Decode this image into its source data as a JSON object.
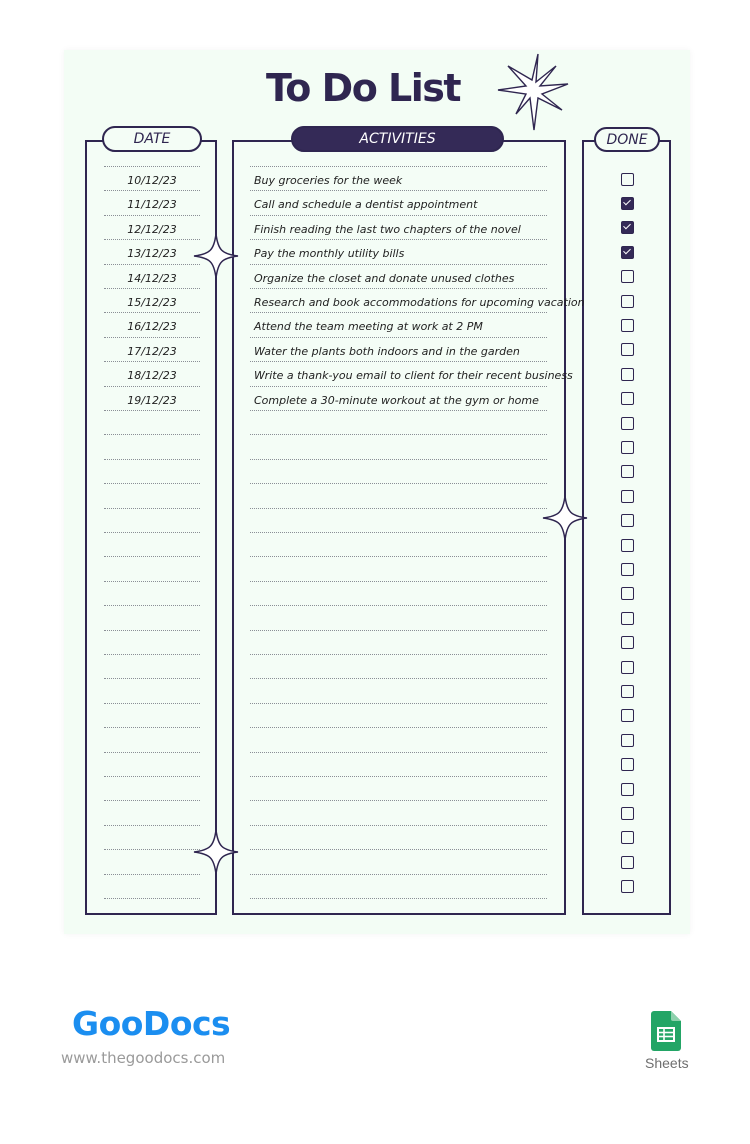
{
  "title": "To Do List",
  "columns": {
    "date": "DATE",
    "activities": "ACTIVITIES",
    "done": "DONE"
  },
  "rows": [
    {
      "date": "10/12/23",
      "activity": "Buy groceries for the week",
      "done": false
    },
    {
      "date": "11/12/23",
      "activity": "Call and schedule a dentist appointment",
      "done": true
    },
    {
      "date": "12/12/23",
      "activity": "Finish reading the last two chapters of the novel",
      "done": true
    },
    {
      "date": "13/12/23",
      "activity": "Pay the monthly utility bills",
      "done": true
    },
    {
      "date": "14/12/23",
      "activity": "Organize the closet and donate unused clothes",
      "done": false
    },
    {
      "date": "15/12/23",
      "activity": "Research and book accommodations for upcoming vacation",
      "done": false
    },
    {
      "date": "16/12/23",
      "activity": "Attend the team meeting at work at 2 PM",
      "done": false
    },
    {
      "date": "17/12/23",
      "activity": "Water the plants both indoors and in the garden",
      "done": false
    },
    {
      "date": "18/12/23",
      "activity": "Write a thank-you email to client for their recent business",
      "done": false
    },
    {
      "date": "19/12/23",
      "activity": "Complete a 30-minute workout at the gym or home",
      "done": false
    }
  ],
  "total_rows": 30,
  "colors": {
    "ink": "#2f2650",
    "page": "#f3fdf5",
    "brand": "#1b8ef0",
    "sheets_green": "#23a566"
  },
  "footer": {
    "brand": "GooDocs",
    "url": "www.thegoodocs.com",
    "app_label": "Sheets",
    "app_icon": "google-sheets-icon"
  }
}
